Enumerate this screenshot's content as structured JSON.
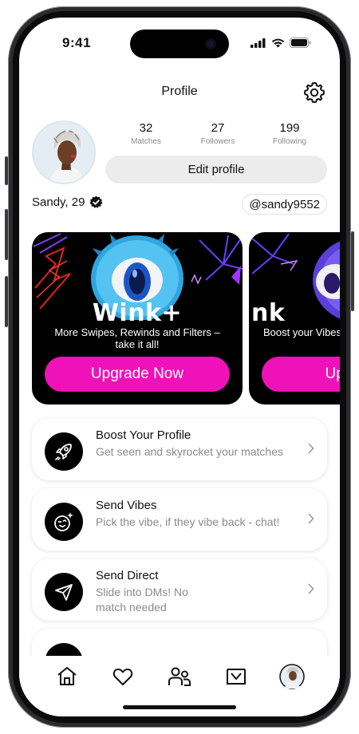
{
  "status_bar": {
    "time": "9:41"
  },
  "header": {
    "title": "Profile",
    "settings_icon": "gear-icon"
  },
  "profile": {
    "stats": [
      {
        "value": "32",
        "label": "Matches"
      },
      {
        "value": "27",
        "label": "Followers"
      },
      {
        "value": "199",
        "label": "Following"
      }
    ],
    "edit_label": "Edit profile",
    "name": "Sandy, 29",
    "verified_icon": "verified-badge-icon",
    "handle": "@sandy9552"
  },
  "promos": [
    {
      "brand": "Wink+",
      "description": "More Swipes, Rewinds and Filters – take it all!",
      "cta": "Upgrade Now"
    },
    {
      "brand": "Wink",
      "description": "Boost your Vibes",
      "cta": "Upgrade"
    }
  ],
  "features": [
    {
      "title": "Boost Your Profile",
      "subtitle": "Get seen and skyrocket your matches",
      "icon": "rocket-icon"
    },
    {
      "title": "Send Vibes",
      "subtitle": "Pick the vibe, if they vibe back - chat!",
      "icon": "wink-face-icon"
    },
    {
      "title": "Send Direct",
      "subtitle": "Slide into DMs! No match needed",
      "icon": "paper-plane-icon"
    }
  ],
  "tabbar": {
    "items": [
      "home-icon",
      "heart-icon",
      "people-icon",
      "inbox-icon",
      "profile-avatar"
    ]
  },
  "colors": {
    "accent": "#ee12b8",
    "card_bg": "#000000",
    "muted_text": "#8b8b8b"
  }
}
